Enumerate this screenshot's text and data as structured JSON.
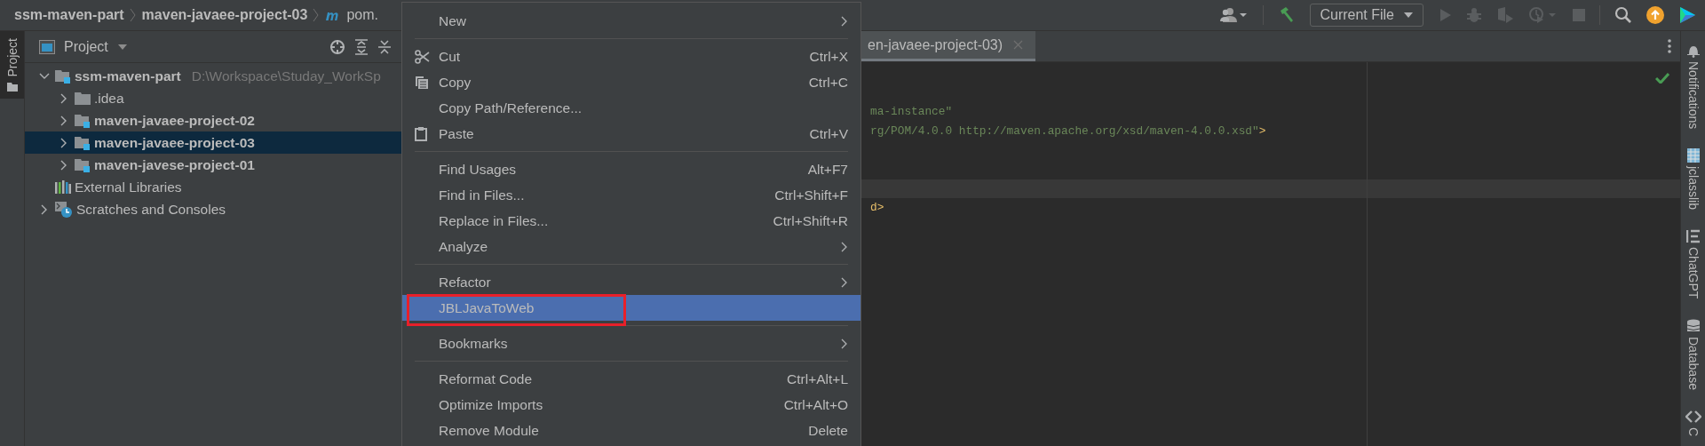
{
  "top_bar": {
    "breadcrumbs": [
      {
        "label": "ssm-maven-part",
        "kind": "folder"
      },
      {
        "label": "maven-javaee-project-03",
        "kind": "folder"
      },
      {
        "label": "pom.",
        "kind": "maven-file"
      }
    ],
    "run_config": "Current File"
  },
  "left_strip": {
    "tabs": [
      {
        "label": "Project",
        "selected": true
      }
    ]
  },
  "project_panel": {
    "title": "Project",
    "tree": [
      {
        "label": "ssm-maven-part",
        "path": "D:\\Workspace\\Studay_WorkSp",
        "kind": "module",
        "expanded": true,
        "selected": false,
        "children": [
          {
            "label": ".idea",
            "kind": "folder",
            "expanded": false,
            "selected": false
          },
          {
            "label": "maven-javaee-project-02",
            "kind": "module",
            "expanded": false,
            "selected": false
          },
          {
            "label": "maven-javaee-project-03",
            "kind": "module",
            "expanded": false,
            "selected": true
          },
          {
            "label": "maven-javese-project-01",
            "kind": "module",
            "expanded": false,
            "selected": false
          }
        ]
      },
      {
        "label": "External Libraries",
        "kind": "libraries",
        "selected": false
      },
      {
        "label": "Scratches and Consoles",
        "kind": "scratches",
        "expanded": false,
        "selected": false
      }
    ]
  },
  "editor": {
    "tab": "en-javaee-project-03)",
    "lines": [
      {
        "current": false
      },
      {
        "current": false
      },
      {
        "current": false,
        "segments": [
          {
            "text": "ma-instance\"",
            "kind": "string"
          }
        ]
      },
      {
        "current": false,
        "segments": [
          {
            "text": "rg/POM/4.0.0 http://maven.apache.org/xsd/maven-4.0.0.xsd\"",
            "kind": "string"
          },
          {
            "text": ">",
            "kind": "tag"
          }
        ]
      },
      {
        "current": false
      },
      {
        "current": false
      },
      {
        "current": true
      },
      {
        "current": false,
        "segments": [
          {
            "text": "d>",
            "kind": "tag"
          }
        ]
      }
    ]
  },
  "context_menu": {
    "items": [
      {
        "kind": "item",
        "label": "New",
        "submenu": true,
        "selected": false
      },
      {
        "kind": "separator"
      },
      {
        "kind": "cut",
        "label": "Cut",
        "shortcut": "Ctrl+X",
        "selected": false
      },
      {
        "kind": "copy",
        "label": "Copy",
        "shortcut": "Ctrl+C",
        "selected": false
      },
      {
        "kind": "item",
        "label": "Copy Path/Reference...",
        "selected": false
      },
      {
        "kind": "paste",
        "label": "Paste",
        "shortcut": "Ctrl+V",
        "selected": false
      },
      {
        "kind": "separator"
      },
      {
        "kind": "item",
        "label": "Find Usages",
        "shortcut": "Alt+F7",
        "selected": false
      },
      {
        "kind": "item",
        "label": "Find in Files...",
        "shortcut": "Ctrl+Shift+F",
        "selected": false
      },
      {
        "kind": "item",
        "label": "Replace in Files...",
        "shortcut": "Ctrl+Shift+R",
        "selected": false
      },
      {
        "kind": "item",
        "label": "Analyze",
        "submenu": true,
        "selected": false
      },
      {
        "kind": "separator"
      },
      {
        "kind": "item",
        "label": "Refactor",
        "submenu": true,
        "selected": false
      },
      {
        "kind": "item",
        "label": "JBLJavaToWeb",
        "selected": true,
        "annotated": true
      },
      {
        "kind": "separator"
      },
      {
        "kind": "item",
        "label": "Bookmarks",
        "submenu": true,
        "selected": false
      },
      {
        "kind": "separator"
      },
      {
        "kind": "item",
        "label": "Reformat Code",
        "shortcut": "Ctrl+Alt+L",
        "selected": false
      },
      {
        "kind": "item",
        "label": "Optimize Imports",
        "shortcut": "Ctrl+Alt+O",
        "selected": false
      },
      {
        "kind": "item",
        "label": "Remove Module",
        "shortcut": "Delete",
        "selected": false
      }
    ]
  },
  "right_strip": {
    "tabs": [
      {
        "label": "Notifications",
        "kind": "bell"
      },
      {
        "label": "jclasslib",
        "kind": "grid"
      },
      {
        "label": "ChatGPT",
        "kind": "chat"
      },
      {
        "label": "Database",
        "kind": "database"
      },
      {
        "label": "C",
        "kind": "code"
      }
    ]
  }
}
